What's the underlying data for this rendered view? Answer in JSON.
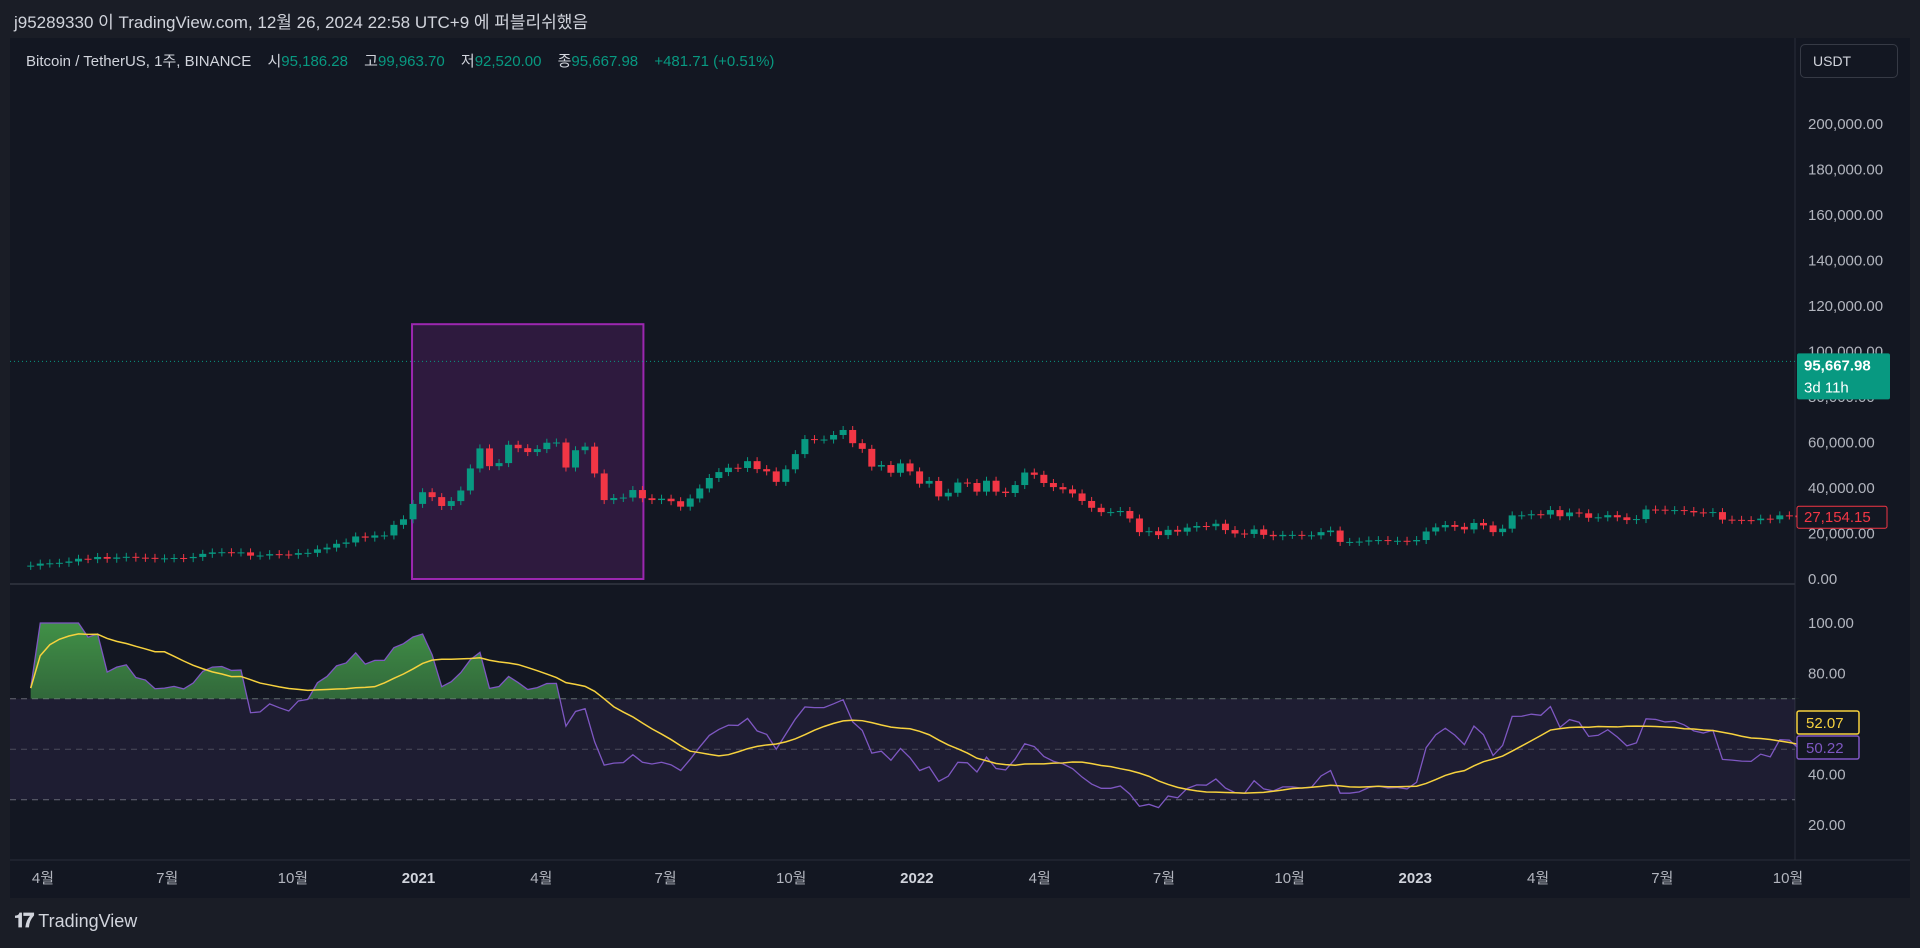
{
  "publish_line": "j95289330 이 TradingView.com, 12월 26, 2024 22:58 UTC+9 에 퍼블리쉬했음",
  "legend": {
    "symbol": "Bitcoin / TetherUS, 1주, BINANCE",
    "open_label": "시",
    "open": "95,186.28",
    "high_label": "고",
    "high": "99,963.70",
    "low_label": "저",
    "low": "92,520.00",
    "close_label": "종",
    "close": "95,667.98",
    "change": "+481.71 (+0.51%)"
  },
  "currency_button": "USDT",
  "footer_brand": "TradingView",
  "colors": {
    "up": "#089981",
    "down": "#f23645",
    "rsi": "#7e57c2",
    "rsi_ma": "#f7d23e",
    "highlight_box": "#9c27b0",
    "background": "#131722"
  },
  "chart_data": [
    {
      "type": "candlestick",
      "interval": "1W",
      "period": "2020-03-23 to 2023-10-09",
      "close": [
        5880,
        6770,
        6900,
        7120,
        7700,
        8900,
        8720,
        9680,
        8900,
        9450,
        9750,
        9380,
        9300,
        9010,
        9070,
        9240,
        9160,
        9700,
        11050,
        11680,
        11770,
        11650,
        11700,
        10260,
        10320,
        10920,
        10780,
        10660,
        11380,
        11500,
        13030,
        13800,
        15480,
        16050,
        18700,
        18180,
        19150,
        19150,
        23800,
        26250,
        33000,
        38150,
        36000,
        32100,
        34250,
        38900,
        48600,
        57400,
        49600,
        50950,
        59000,
        57500,
        55800,
        57100,
        59900,
        60000,
        49000,
        56600,
        58200,
        46400,
        34700,
        35600,
        35800,
        39100,
        35500,
        34700,
        35300,
        34200,
        31800,
        35400,
        39800,
        44400,
        47000,
        48900,
        48800,
        51800,
        48300,
        47300,
        42700,
        48200,
        54900,
        61500,
        61300,
        61300,
        63300,
        65500,
        59700,
        57200,
        49400,
        50100,
        46700,
        50800,
        47300,
        41900,
        43100,
        36300,
        37900,
        42400,
        42200,
        38400,
        43200,
        38400,
        37800,
        41300,
        46800,
        45800,
        42200,
        40400,
        39400,
        37600,
        34300,
        31300,
        29400,
        29400,
        29900,
        26600,
        20600,
        21000,
        19300,
        21600,
        20800,
        22600,
        23300,
        23200,
        24300,
        21500,
        20000,
        19800,
        21800,
        19400,
        18800,
        19400,
        19400,
        19100,
        19200,
        20600,
        21300,
        16300,
        16300,
        16450,
        16950,
        17100,
        16750,
        16800,
        16550,
        17130,
        20880,
        22700,
        23730,
        22930,
        21780,
        24630,
        23550,
        20600,
        22130,
        27960,
        27990,
        28470,
        28330,
        30300,
        27590,
        29230,
        28880,
        26910,
        27100,
        28070,
        27120,
        25900,
        26340,
        30540,
        30470,
        30170,
        30290,
        29900,
        29280,
        29050,
        29410,
        26090,
        26000,
        25870,
        25840,
        26530,
        26250,
        27970,
        27920,
        27154
      ],
      "y_ticks": [
        "0.00",
        "20,000.00",
        "40,000.00",
        "60,000.00",
        "80,000.00",
        "100,000.00",
        "120,000.00",
        "140,000.00",
        "160,000.00",
        "180,000.00",
        "200,000.00"
      ],
      "ylim": [
        0,
        200000
      ],
      "x_ticks": [
        {
          "date": "2020-04-01",
          "label": "4월"
        },
        {
          "date": "2020-07-01",
          "label": "7월"
        },
        {
          "date": "2020-10-01",
          "label": "10월"
        },
        {
          "date": "2021-01-01",
          "label": "2021",
          "bold": true
        },
        {
          "date": "2021-04-01",
          "label": "4월"
        },
        {
          "date": "2021-07-01",
          "label": "7월"
        },
        {
          "date": "2021-10-01",
          "label": "10월"
        },
        {
          "date": "2022-01-01",
          "label": "2022",
          "bold": true
        },
        {
          "date": "2022-04-01",
          "label": "4월"
        },
        {
          "date": "2022-07-01",
          "label": "7월"
        },
        {
          "date": "2022-10-01",
          "label": "10월"
        },
        {
          "date": "2023-01-01",
          "label": "2023",
          "bold": true
        },
        {
          "date": "2023-04-01",
          "label": "4월"
        },
        {
          "date": "2023-07-01",
          "label": "7월"
        },
        {
          "date": "2023-10-01",
          "label": "10월"
        }
      ],
      "last_price_label": "27,154.15",
      "current_price": {
        "value": 95667.98,
        "label": "95,667.98",
        "countdown": "3d 11h"
      },
      "highlight_box": {
        "from": "2020-12-28",
        "to": "2021-06-14",
        "price_low": 0,
        "price_high": 112000
      }
    },
    {
      "type": "line",
      "indicator": "RSI",
      "period": 14,
      "ylim": [
        10,
        110
      ],
      "y_ticks": [
        "20.00",
        "40.00",
        "60.00",
        "80.00",
        "100.00"
      ],
      "bands": [
        30,
        50,
        70
      ],
      "rsi_last": "50.22",
      "rsi_ma_last": "52.07"
    }
  ]
}
